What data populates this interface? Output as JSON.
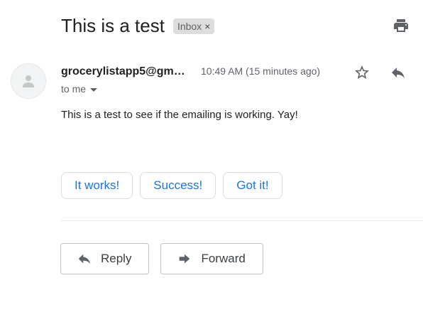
{
  "header": {
    "subject": "This is a test",
    "label_chip": "Inbox",
    "chip_remove_glyph": "×",
    "print_icon": "print-icon"
  },
  "message": {
    "sender": "grocerylistapp5@gm…",
    "timestamp": "10:49 AM (15 minutes ago)",
    "recipients": "to me",
    "body": "This is a test to see if the emailing is working. Yay!",
    "avatar_icon": "person-icon",
    "star_icon": "star-outline-icon",
    "reply_icon": "reply-icon"
  },
  "smart_replies": [
    "It works!",
    "Success!",
    "Got it!"
  ],
  "actions": {
    "reply_label": "Reply",
    "forward_label": "Forward"
  },
  "colors": {
    "accent": "#1a73e8",
    "text_primary": "#202124",
    "text_secondary": "#5f6368"
  }
}
